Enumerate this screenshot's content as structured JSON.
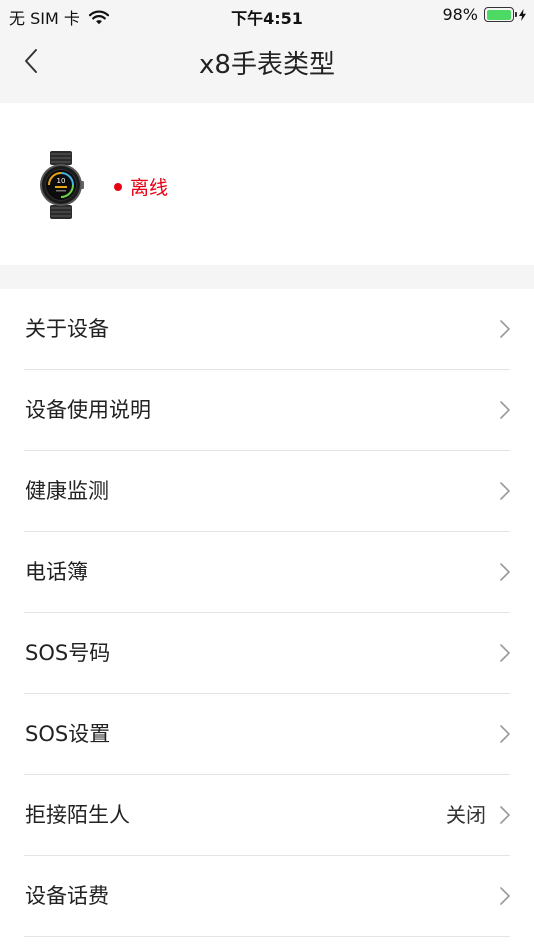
{
  "status_bar": {
    "carrier": "无 SIM 卡",
    "time": "下午4:51",
    "battery_percent": "98%",
    "battery_level": 0.98,
    "battery_color": "#4cd964"
  },
  "nav": {
    "back_icon": "chevron-left-icon",
    "title": "x8手表类型"
  },
  "device": {
    "image_icon": "smartwatch-icon",
    "status_text": "离线",
    "status_color": "#e60012"
  },
  "menu": {
    "items": [
      {
        "label": "关于设备",
        "value": ""
      },
      {
        "label": "设备使用说明",
        "value": ""
      },
      {
        "label": "健康监测",
        "value": ""
      },
      {
        "label": "电话簿",
        "value": ""
      },
      {
        "label": "SOS号码",
        "value": ""
      },
      {
        "label": "SOS设置",
        "value": ""
      },
      {
        "label": "拒接陌生人",
        "value": "关闭"
      },
      {
        "label": "设备话费",
        "value": ""
      }
    ],
    "chevron_icon": "chevron-right-icon"
  }
}
